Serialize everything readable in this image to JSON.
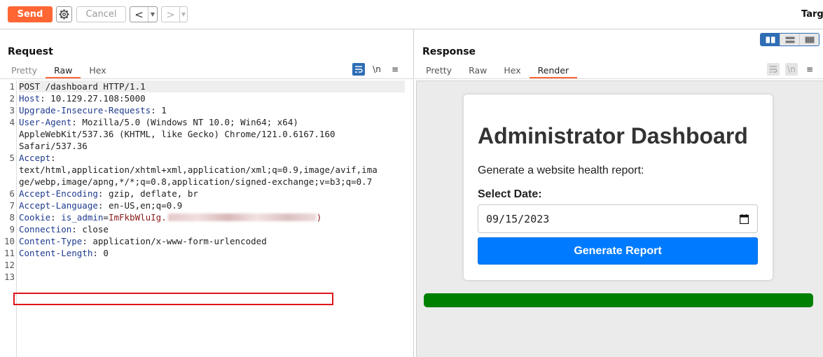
{
  "toolbar": {
    "send_label": "Send",
    "cancel_label": "Cancel",
    "prev_glyph": "<",
    "next_glyph": ">",
    "dropdown_glyph": "▼",
    "target_label": "Targe"
  },
  "request": {
    "title": "Request",
    "tabs": [
      {
        "label": "Pretty",
        "active": false
      },
      {
        "label": "Raw",
        "active": true
      },
      {
        "label": "Hex",
        "active": false
      }
    ],
    "newline_toggle": "\\n",
    "menu_glyph": "≡",
    "lines": [
      {
        "n": "1",
        "text": "POST /dashboard HTTP/1.1"
      },
      {
        "n": "2",
        "key": "Host",
        "value": " 10.129.27.108:5000"
      },
      {
        "n": "3",
        "key": "Upgrade-Insecure-Requests",
        "value": " 1"
      },
      {
        "n": "4",
        "key": "User-Agent",
        "value": " Mozilla/5.0 (Windows NT 10.0; Win64; x64)"
      },
      {
        "n": "",
        "text": "AppleWebKit/537.36 (KHTML, like Gecko) Chrome/121.0.6167.160"
      },
      {
        "n": "",
        "text": "Safari/537.36"
      },
      {
        "n": "5",
        "key": "Accept",
        "value": ""
      },
      {
        "n": "",
        "text": "text/html,application/xhtml+xml,application/xml;q=0.9,image/avif,ima"
      },
      {
        "n": "",
        "text": "ge/webp,image/apng,*/*;q=0.8,application/signed-exchange;v=b3;q=0.7"
      },
      {
        "n": "6",
        "key": "Accept-Encoding",
        "value": " gzip, deflate, br"
      },
      {
        "n": "7",
        "key": "Accept-Language",
        "value": " en-US,en;q=0.9"
      },
      {
        "n": "8",
        "key": "Cookie",
        "value": " is_admin",
        "cookie_value": "ImFkbWluIg.",
        "cookie_end": ")"
      },
      {
        "n": "9",
        "key": "Connection",
        "value": " close"
      },
      {
        "n": "10",
        "key": "Content-Type",
        "value": " application/x-www-form-urlencoded"
      },
      {
        "n": "11",
        "key": "Content-Length",
        "value": " 0"
      },
      {
        "n": "12",
        "text": ""
      },
      {
        "n": "13",
        "text": ""
      }
    ]
  },
  "response": {
    "title": "Response",
    "tabs": [
      {
        "label": "Pretty",
        "active": false
      },
      {
        "label": "Raw",
        "active": false
      },
      {
        "label": "Hex",
        "active": false
      },
      {
        "label": "Render",
        "active": true
      }
    ],
    "newline_toggle": "\\n",
    "menu_glyph": "≡",
    "render": {
      "title": "Administrator Dashboard",
      "subtitle": "Generate a website health report:",
      "date_label": "Select Date:",
      "date_value": "09/15/2023",
      "button_label": "Generate Report"
    }
  },
  "colors": {
    "accent": "#ff6633",
    "highlight_box": "#e0141b",
    "header_key": "#1f3b8f",
    "primary_button": "#007bff",
    "progress": "#008000"
  }
}
